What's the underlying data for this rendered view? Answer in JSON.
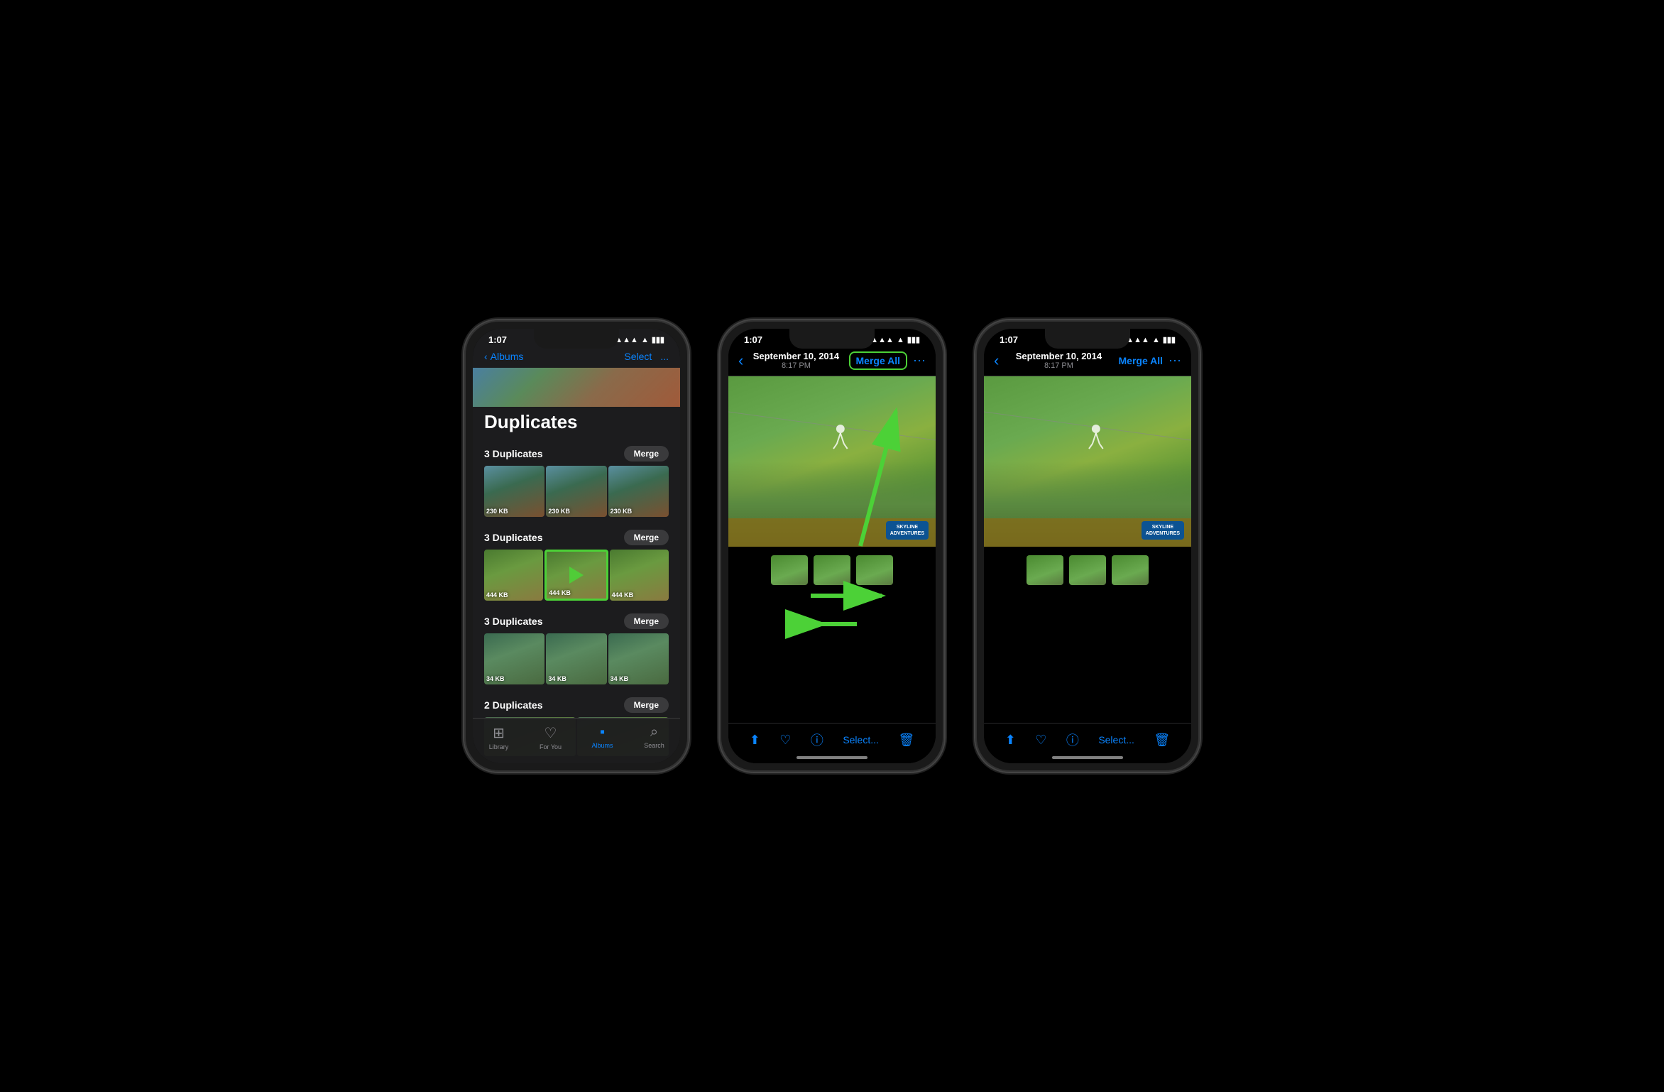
{
  "phones": [
    {
      "id": "phone1",
      "type": "list",
      "statusBar": {
        "time": "1:07",
        "icons": "▲▲▲ ▲ ▮▮▮"
      },
      "nav": {
        "back": "Albums",
        "selectLabel": "Select",
        "moreLabel": "..."
      },
      "pageTitle": "Duplicates",
      "groups": [
        {
          "label": "3 Duplicates",
          "mergeLabel": "Merge",
          "thumbSizes": [
            "230 KB",
            "230 KB",
            "230 KB"
          ],
          "type": "group1"
        },
        {
          "label": "3 Duplicates",
          "mergeLabel": "Merge",
          "thumbSizes": [
            "444 KB",
            "444 KB",
            "444 KB"
          ],
          "type": "group2"
        },
        {
          "label": "3 Duplicates",
          "mergeLabel": "Merge",
          "thumbSizes": [
            "34 KB",
            "34 KB",
            "34 KB"
          ],
          "type": "group3"
        },
        {
          "label": "2 Duplicates",
          "mergeLabel": "Merge",
          "thumbSizes": [],
          "type": "group4"
        }
      ],
      "tabs": [
        {
          "label": "Library",
          "icon": "⊞",
          "active": false
        },
        {
          "label": "For You",
          "icon": "♡",
          "active": false
        },
        {
          "label": "Albums",
          "icon": "▪",
          "active": true
        },
        {
          "label": "Search",
          "icon": "⌕",
          "active": false
        }
      ]
    },
    {
      "id": "phone2",
      "type": "detail",
      "statusBar": {
        "time": "1:07"
      },
      "nav": {
        "dateTitle": "September 10, 2014",
        "timeSub": "8:17 PM",
        "mergeAllLabel": "Merge All",
        "mergeAllHighlighted": true
      },
      "hasUpArrow": true,
      "hasLeftRightArrows": true,
      "toolbarItems": [
        "share",
        "heart",
        "info",
        "select",
        "delete"
      ]
    },
    {
      "id": "phone3",
      "type": "detail",
      "statusBar": {
        "time": "1:07"
      },
      "nav": {
        "dateTitle": "September 10, 2014",
        "timeSub": "8:17 PM",
        "mergeAllLabel": "Merge All",
        "mergeAllHighlighted": false
      },
      "hasUpArrow": false,
      "hasLeftRightArrows": false,
      "toolbarItems": [
        "share",
        "heart",
        "info",
        "select",
        "delete"
      ]
    }
  ],
  "labels": {
    "selectBtn": "Select...",
    "deleteBtn": "🗑",
    "shareBtn": "⬆",
    "heartBtn": "♡",
    "infoBtn": "ⓘ",
    "moreBtn": "···"
  }
}
